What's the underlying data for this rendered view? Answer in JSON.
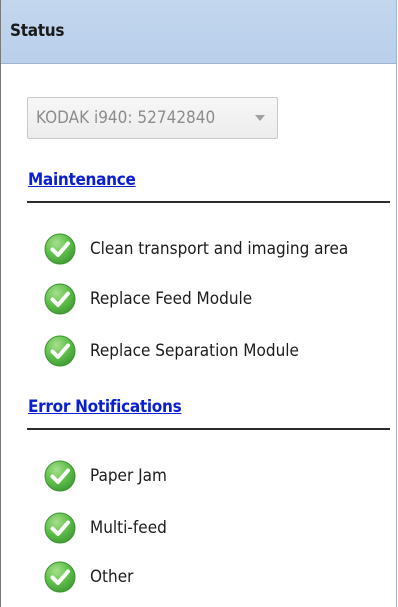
{
  "panel": {
    "title": "Status"
  },
  "scanner_select": {
    "value": "KODAK i940: 52742840"
  },
  "maintenance": {
    "heading": "Maintenance",
    "items": [
      {
        "label": "Clean transport and imaging area",
        "status_icon": "green-check-icon"
      },
      {
        "label": "Replace Feed Module",
        "status_icon": "green-check-icon"
      },
      {
        "label": "Replace Separation Module",
        "status_icon": "green-check-icon"
      }
    ]
  },
  "errors": {
    "heading": "Error Notifications",
    "items": [
      {
        "label": "Paper Jam",
        "status_icon": "green-check-icon"
      },
      {
        "label": "Multi-feed",
        "status_icon": "green-check-icon"
      },
      {
        "label": "Other",
        "status_icon": "green-check-icon"
      }
    ]
  },
  "colors": {
    "titlebar": "#c3d6ee",
    "link": "#0a1fd1",
    "check_green": "#58b948"
  }
}
